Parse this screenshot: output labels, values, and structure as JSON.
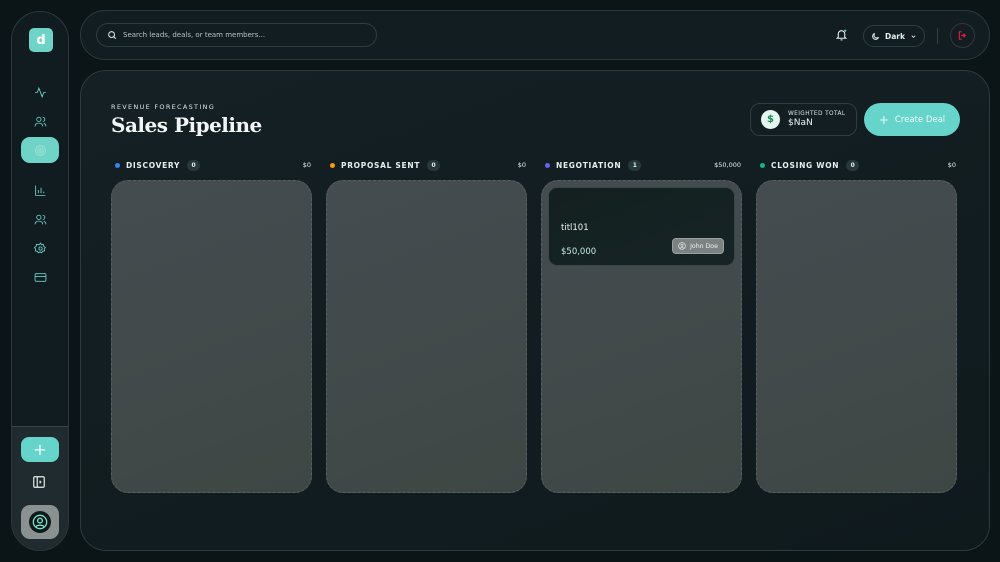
{
  "sidebar": {
    "logo": "d",
    "nav": [
      {
        "icon": "activity-icon"
      },
      {
        "icon": "users-icon"
      },
      {
        "icon": "target-icon",
        "active": true
      },
      {
        "icon": "bar-chart-icon"
      },
      {
        "icon": "contacts-icon"
      },
      {
        "icon": "settings-icon"
      },
      {
        "icon": "card-icon"
      }
    ],
    "add_label": "+"
  },
  "topbar": {
    "search_placeholder": "Search leads, deals, or team members...",
    "theme_label": "Dark"
  },
  "header": {
    "eyebrow": "REVENUE FORECASTING",
    "title": "Sales Pipeline",
    "weighted_label": "WEIGHTED TOTAL",
    "weighted_value": "$NaN",
    "create_label": "Create Deal"
  },
  "columns": [
    {
      "name": "DISCOVERY",
      "count": "0",
      "amount": "$0",
      "color": "#3b82f6"
    },
    {
      "name": "PROPOSAL SENT",
      "count": "0",
      "amount": "$0",
      "color": "#f59e0b"
    },
    {
      "name": "NEGOTIATION",
      "count": "1",
      "amount": "$50,000",
      "color": "#6366f1"
    },
    {
      "name": "CLOSING WON",
      "count": "0",
      "amount": "$0",
      "color": "#10b981"
    }
  ],
  "deal": {
    "title": "titl101",
    "amount": "$50,000",
    "owner": "John Doe"
  },
  "colors": {
    "accent": "#66d4cb",
    "logout": "#e11d48"
  }
}
